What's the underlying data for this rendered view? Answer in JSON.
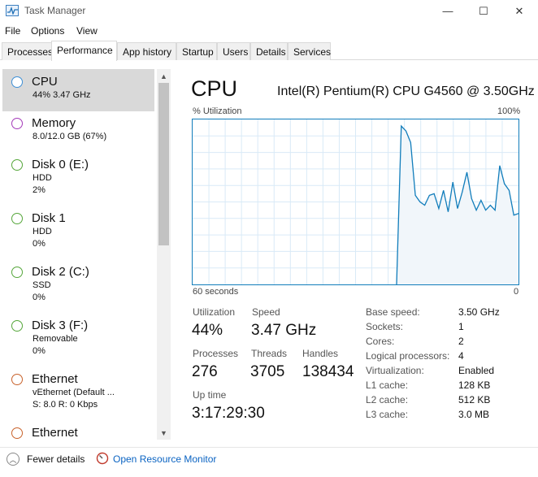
{
  "window": {
    "title": "Task Manager",
    "min_glyph": "—",
    "max_glyph": "☐",
    "close_glyph": "✕"
  },
  "menu": [
    "File",
    "Options",
    "View"
  ],
  "tabs": [
    {
      "label": "Processes",
      "active": false
    },
    {
      "label": "Performance",
      "active": true
    },
    {
      "label": "App history",
      "active": false
    },
    {
      "label": "Startup",
      "active": false
    },
    {
      "label": "Users",
      "active": false
    },
    {
      "label": "Details",
      "active": false
    },
    {
      "label": "Services",
      "active": false
    }
  ],
  "resources": [
    {
      "name": "CPU",
      "sub1": "44% 3.47 GHz",
      "sub2": "",
      "color": "#3d8fd6",
      "selected": true
    },
    {
      "name": "Memory",
      "sub1": "8.0/12.0 GB (67%)",
      "sub2": "",
      "color": "#a43ab9",
      "selected": false
    },
    {
      "name": "Disk 0 (E:)",
      "sub1": "HDD",
      "sub2": "2%",
      "color": "#55a63a",
      "selected": false
    },
    {
      "name": "Disk 1",
      "sub1": "HDD",
      "sub2": "0%",
      "color": "#55a63a",
      "selected": false
    },
    {
      "name": "Disk 2 (C:)",
      "sub1": "SSD",
      "sub2": "0%",
      "color": "#55a63a",
      "selected": false
    },
    {
      "name": "Disk 3 (F:)",
      "sub1": "Removable",
      "sub2": "0%",
      "color": "#55a63a",
      "selected": false
    },
    {
      "name": "Ethernet",
      "sub1": "vEthernet (Default ...",
      "sub2": "S: 8.0 R: 0 Kbps",
      "color": "#c8622b",
      "selected": false
    },
    {
      "name": "Ethernet",
      "sub1": "",
      "sub2": "",
      "color": "#c8622b",
      "selected": false
    }
  ],
  "cpu": {
    "title": "CPU",
    "model": "Intel(R) Pentium(R) CPU G4560 @ 3.50GHz",
    "util_label": "% Utilization",
    "util_max": "100%",
    "time_label": "60 seconds",
    "time_zero": "0",
    "graph_color": "#117dbb",
    "utilization_history": [
      0,
      0,
      0,
      0,
      0,
      0,
      0,
      0,
      0,
      0,
      0,
      0,
      0,
      0,
      0,
      0,
      0,
      0,
      0,
      0,
      0,
      0,
      0,
      0,
      0,
      0,
      0,
      0,
      0,
      0,
      0,
      0,
      0,
      0,
      0,
      0,
      0,
      0,
      0,
      0,
      0,
      0,
      0,
      0,
      0,
      0,
      0,
      0,
      0,
      0,
      0,
      0,
      0,
      0,
      0,
      0,
      0,
      0,
      0,
      0,
      0,
      0,
      0,
      0,
      0,
      0,
      0,
      0,
      0,
      0,
      0,
      0,
      0,
      0,
      0,
      0,
      0,
      0,
      0,
      0,
      0,
      0,
      0,
      0,
      0,
      0,
      0,
      0,
      0,
      0,
      0,
      0,
      0,
      0,
      0,
      0,
      0,
      0,
      0,
      0,
      0,
      0,
      0,
      0,
      0,
      0,
      0,
      0,
      0,
      0,
      0,
      0,
      0,
      0,
      0,
      0,
      0,
      0,
      0,
      0,
      0,
      0,
      0,
      0,
      0,
      0,
      0,
      0,
      0,
      0,
      0,
      0,
      0,
      0,
      0,
      0,
      0,
      0,
      0,
      0,
      0,
      0,
      0,
      0,
      0,
      0,
      0,
      0,
      0,
      0,
      0,
      0,
      0,
      0,
      0,
      0,
      0,
      0,
      0,
      0,
      0,
      0,
      0,
      0,
      0,
      0,
      0,
      0,
      0,
      0,
      0,
      0,
      0,
      0,
      0,
      0,
      0,
      0,
      0,
      0,
      0,
      0,
      0,
      0,
      0,
      0,
      0,
      0,
      0,
      0,
      0,
      0,
      0,
      0,
      0,
      0,
      0,
      0,
      0,
      0,
      0,
      0,
      0,
      0,
      0,
      0,
      0,
      0,
      0,
      0,
      0,
      0,
      0,
      0,
      0,
      0,
      0,
      0,
      0,
      0,
      0,
      0,
      0,
      0,
      0,
      0,
      0,
      0,
      0,
      0,
      0,
      0,
      0,
      0,
      0,
      0,
      0,
      0,
      0,
      0,
      0,
      0,
      0,
      0,
      0,
      0,
      0,
      0,
      0,
      0,
      0,
      0,
      0,
      0,
      0,
      0,
      0,
      0,
      0,
      0,
      0,
      0,
      0,
      0
    ],
    "series_recent": [
      0,
      96,
      93,
      86,
      54,
      50,
      48,
      54,
      55,
      46,
      57,
      44,
      62,
      46,
      56,
      68,
      52,
      45,
      51,
      45,
      48,
      45,
      72,
      61,
      57,
      42,
      43
    ],
    "stats": {
      "utilization": {
        "label": "Utilization",
        "value": "44%"
      },
      "speed": {
        "label": "Speed",
        "value": "3.47 GHz"
      },
      "processes": {
        "label": "Processes",
        "value": "276"
      },
      "threads": {
        "label": "Threads",
        "value": "3705"
      },
      "handles": {
        "label": "Handles",
        "value": "138434"
      },
      "uptime": {
        "label": "Up time",
        "value": "3:17:29:30"
      }
    },
    "specs": [
      {
        "label": "Base speed:",
        "value": "3.50 GHz"
      },
      {
        "label": "Sockets:",
        "value": "1"
      },
      {
        "label": "Cores:",
        "value": "2"
      },
      {
        "label": "Logical processors:",
        "value": "4"
      },
      {
        "label": "Virtualization:",
        "value": "Enabled"
      },
      {
        "label": "L1 cache:",
        "value": "128 KB"
      },
      {
        "label": "L2 cache:",
        "value": "512 KB"
      },
      {
        "label": "L3 cache:",
        "value": "3.0 MB"
      }
    ]
  },
  "footer": {
    "fewer_details": "Fewer details",
    "open_monitor": "Open Resource Monitor"
  }
}
